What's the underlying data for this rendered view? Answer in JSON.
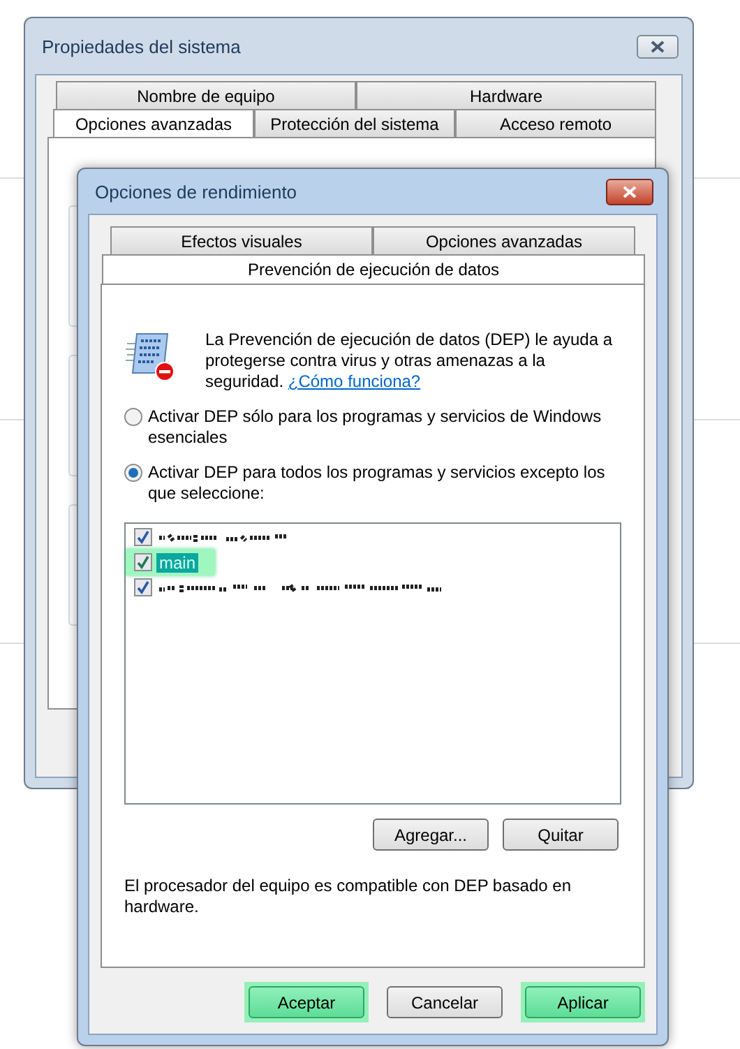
{
  "back_window": {
    "title": "Propiedades del sistema",
    "tab_rows": [
      [
        {
          "label": "Nombre de equipo",
          "selected": false
        },
        {
          "label": "Hardware",
          "selected": false
        }
      ],
      [
        {
          "label": "Opciones avanzadas",
          "selected": true
        },
        {
          "label": "Protección del sistema",
          "selected": false
        },
        {
          "label": "Acceso remoto",
          "selected": false
        }
      ]
    ]
  },
  "dialog": {
    "title": "Opciones de rendimiento",
    "tab_rows": [
      [
        {
          "label": "Efectos visuales",
          "selected": false
        },
        {
          "label": "Opciones avanzadas",
          "selected": false
        }
      ],
      [
        {
          "label": "Prevención de ejecución de datos",
          "selected": true
        }
      ]
    ],
    "intro": "La Prevención de ejecución de datos (DEP) le ayuda a protegerse contra virus y otras amenazas a la seguridad.",
    "link": "¿Cómo funciona?",
    "options": [
      {
        "label": "Activar DEP sólo para los programas y servicios de Windows esenciales",
        "selected": false
      },
      {
        "label": "Activar DEP para todos los programas y servicios excepto los que seleccione:",
        "selected": true
      }
    ],
    "programs": [
      {
        "kind": "redacted",
        "checked": true,
        "highlighted": false
      },
      {
        "kind": "text",
        "label": "main",
        "checked": true,
        "highlighted": true
      },
      {
        "kind": "redacted",
        "checked": true,
        "highlighted": false
      }
    ],
    "list_buttons": [
      "Agregar...",
      "Quitar"
    ],
    "note": "El procesador del equipo es compatible con DEP basado en hardware.",
    "buttons": [
      {
        "label": "Aceptar",
        "highlighted": true
      },
      {
        "label": "Cancelar",
        "highlighted": false
      },
      {
        "label": "Aplicar",
        "highlighted": true
      }
    ]
  }
}
